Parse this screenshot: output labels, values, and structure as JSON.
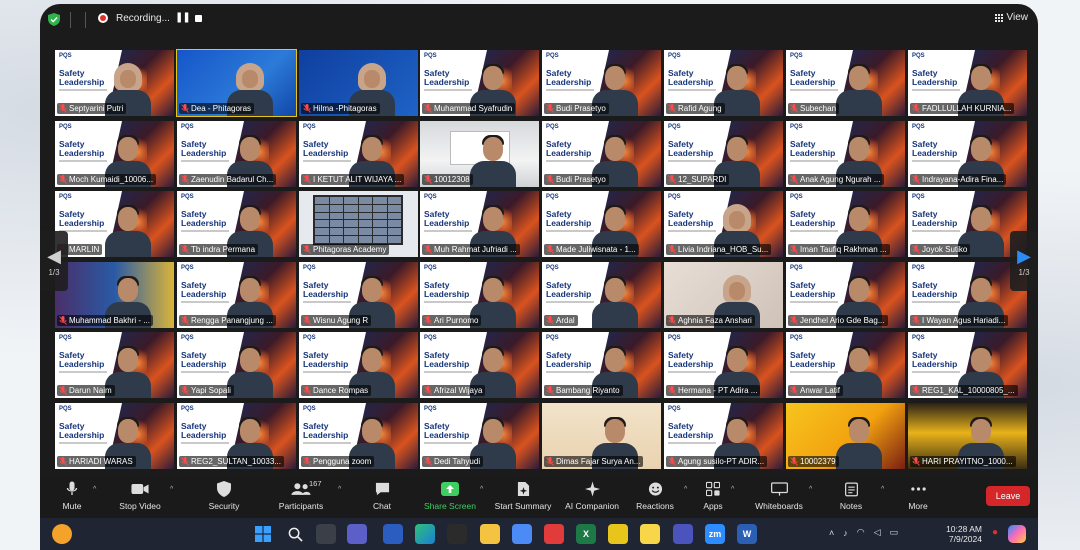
{
  "topbar": {
    "recording_label": "Recording...",
    "view_label": "View"
  },
  "slide": {
    "logo_text": "PQS",
    "title_line1": "Safety",
    "title_line2": "Leadership"
  },
  "participants": [
    {
      "name": "Septyarini Putri",
      "type": "slide",
      "person": "hijab"
    },
    {
      "name": "Dea - Phitagoras",
      "type": "blue",
      "person": "hijab",
      "active": true
    },
    {
      "name": "Hilma -Phitagoras",
      "type": "blue2",
      "person": "hijab"
    },
    {
      "name": "Muhammad Syafrudin",
      "type": "slide",
      "person": "man"
    },
    {
      "name": "Budi Prasetyo",
      "type": "slide",
      "person": "man"
    },
    {
      "name": "Rafid Agung",
      "type": "slide",
      "person": "man"
    },
    {
      "name": "Subechan",
      "type": "slide",
      "person": "man"
    },
    {
      "name": "FADLLULLAH KURNIA...",
      "type": "slide",
      "person": "man"
    },
    {
      "name": "Moch Kumaidi_10006...",
      "type": "slide",
      "person": "man"
    },
    {
      "name": "Zaenudin Badarul Ch...",
      "type": "slide",
      "person": "man"
    },
    {
      "name": "I KETUT ALIT WIJAYA ...",
      "type": "slide",
      "person": "man"
    },
    {
      "name": "10012308",
      "type": "room",
      "person": "man"
    },
    {
      "name": "Budi Prasetyo",
      "type": "slide",
      "person": "man"
    },
    {
      "name": "12_SUPARDI",
      "type": "slide",
      "person": "man"
    },
    {
      "name": "Anak Agung Ngurah ...",
      "type": "slide",
      "person": "man"
    },
    {
      "name": "Indrayana-Adira Fina...",
      "type": "slide",
      "person": "man"
    },
    {
      "name": "MARLIN",
      "type": "slide",
      "person": "man"
    },
    {
      "name": "Tb indra Permana",
      "type": "slide",
      "person": "man"
    },
    {
      "name": "Phitagoras Academy",
      "type": "screen",
      "person": "none"
    },
    {
      "name": "Muh Rahmat Jufriadi ...",
      "type": "slide",
      "person": "man"
    },
    {
      "name": "Made Juliwisnata - 1...",
      "type": "slide",
      "person": "man"
    },
    {
      "name": "Livia Indriana_HOB_Su...",
      "type": "slide",
      "person": "hijab"
    },
    {
      "name": "Iman Taufiq Rakhman ...",
      "type": "slide",
      "person": "man"
    },
    {
      "name": "Joyok Sutiko",
      "type": "slide",
      "person": "man"
    },
    {
      "name": "Muhammad Bakhri - ...",
      "type": "vivid",
      "person": "man"
    },
    {
      "name": "Rengga Panangjung ...",
      "type": "slide",
      "person": "man"
    },
    {
      "name": "Wisnu Agung R",
      "type": "slide",
      "person": "man"
    },
    {
      "name": "Ari Purnomo",
      "type": "slide",
      "person": "man"
    },
    {
      "name": "Ardal",
      "type": "slide",
      "person": "man"
    },
    {
      "name": "Aghnia Faza Anshari",
      "type": "beige",
      "person": "hijab"
    },
    {
      "name": "Jendhel Ario Gde Bag...",
      "type": "slide",
      "person": "man"
    },
    {
      "name": "I Wayan Agus Hariadi...",
      "type": "slide",
      "person": "man"
    },
    {
      "name": "Darun Naim",
      "type": "slide",
      "person": "man"
    },
    {
      "name": "Yapi Sopali",
      "type": "slide",
      "person": "man"
    },
    {
      "name": "Dance Rompas",
      "type": "slide",
      "person": "man"
    },
    {
      "name": "Afrizal Wijaya",
      "type": "slide",
      "person": "man"
    },
    {
      "name": "Bambang Riyanto",
      "type": "slide",
      "person": "man"
    },
    {
      "name": "Hermana - PT Adira ...",
      "type": "slide",
      "person": "man"
    },
    {
      "name": "Anwar Latif",
      "type": "slide",
      "person": "man"
    },
    {
      "name": "REG1_KAL_10000805_...",
      "type": "slide",
      "person": "man"
    },
    {
      "name": "HARIADI WARAS",
      "type": "slide",
      "person": "man"
    },
    {
      "name": "REG2_SULTAN_10033...",
      "type": "slide",
      "person": "man"
    },
    {
      "name": "Pengguna zoom",
      "type": "slide",
      "person": "man"
    },
    {
      "name": "Dedi Tahyudi",
      "type": "slide",
      "person": "man"
    },
    {
      "name": "Dimas Fajar Surya An...",
      "type": "light",
      "person": "man"
    },
    {
      "name": "Agung susilo-PT ADIR...",
      "type": "slide",
      "person": "man"
    },
    {
      "name": "10002379",
      "type": "yellow",
      "person": "man"
    },
    {
      "name": "HARI PRAYITNO_1000...",
      "type": "yellow2",
      "person": "man"
    }
  ],
  "pagination": {
    "left_page": "1/3",
    "right_page": "1/3"
  },
  "toolbar": {
    "mute": "Mute",
    "stop_video": "Stop Video",
    "security": "Security",
    "participants": "Participants",
    "participants_count": "167",
    "chat": "Chat",
    "share_screen": "Share Screen",
    "start_summary": "Start Summary",
    "ai_companion": "AI Companion",
    "reactions": "Reactions",
    "apps": "Apps",
    "whiteboards": "Whiteboards",
    "notes": "Notes",
    "more": "More",
    "leave": "Leave"
  },
  "taskbar": {
    "time": "10:28 AM",
    "date": "7/9/2024",
    "zoom_label": "zm",
    "excel_label": "X",
    "word_label": "W"
  },
  "colors": {
    "share_green": "#3fcf61",
    "leave_red": "#d5262a",
    "active_speaker": "#e8c51b",
    "next_arrow": "#2b8cf5"
  }
}
